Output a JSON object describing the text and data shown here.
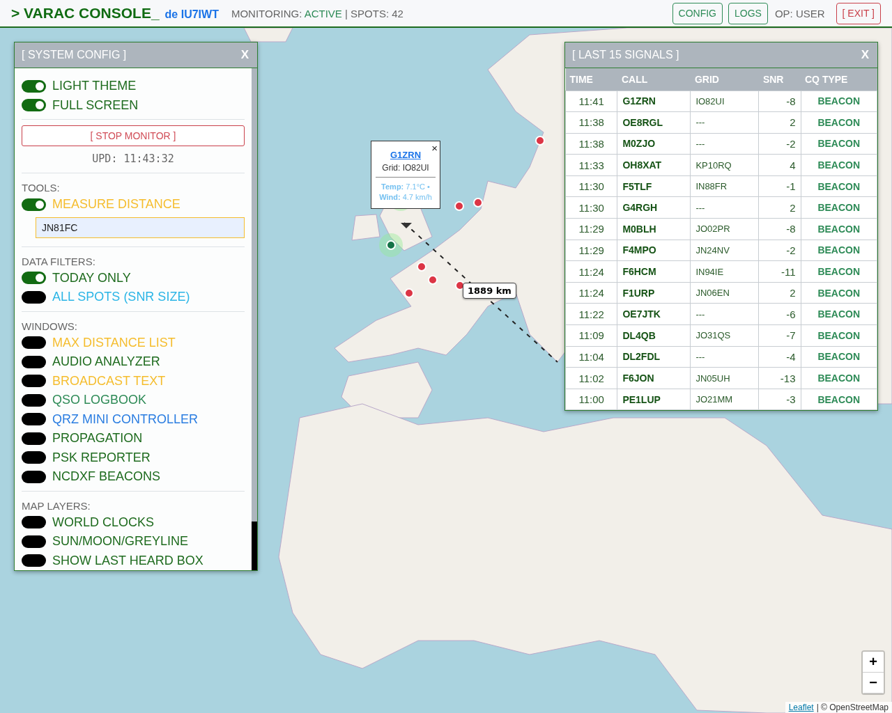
{
  "header": {
    "prompt": ">",
    "title": "VARAC CONSOLE_",
    "callsign": "de IU7IWT",
    "monitoring_label": "MONITORING:",
    "monitoring_value": "ACTIVE",
    "spots": "| SPOTS: 42",
    "buttons": [
      "CONFIG",
      "LOGS"
    ],
    "operator": "OP: USER",
    "exit": "[ EXIT ]"
  },
  "config_panel": {
    "title": "[ SYSTEM CONFIG ]",
    "close": "X",
    "top_toggles": [
      {
        "label": "LIGHT THEME",
        "on": true,
        "color": "#1e6b1e"
      },
      {
        "label": "FULL SCREEN",
        "on": true,
        "color": "#1e6b1e"
      }
    ],
    "stop_button": "[ STOP MONITOR ]",
    "updated": "UPD: 11:43:32",
    "sections": [
      {
        "title": "TOOLS:",
        "toggles": [
          {
            "label": "MEASURE DISTANCE",
            "on": true,
            "color": "#f5bd2e"
          }
        ],
        "locator": "JN81FC"
      },
      {
        "title": "DATA FILTERS:",
        "toggles": [
          {
            "label": "TODAY ONLY",
            "on": true,
            "color": "#1e6b1e"
          },
          {
            "label": "ALL SPOTS (SNR SIZE)",
            "on": false,
            "color": "#2bb5e6"
          }
        ]
      },
      {
        "title": "WINDOWS:",
        "toggles": [
          {
            "label": "MAX DISTANCE LIST",
            "on": false,
            "color": "#f5bd2e"
          },
          {
            "label": "AUDIO ANALYZER",
            "on": false,
            "color": "#1e6b1e"
          },
          {
            "label": "BROADCAST TEXT",
            "on": false,
            "color": "#f5bd2e"
          },
          {
            "label": "QSO LOGBOOK",
            "on": false,
            "color": "#2e8b57"
          },
          {
            "label": "QRZ MINI CONTROLLER",
            "on": false,
            "color": "#2a7de1"
          },
          {
            "label": "PROPAGATION",
            "on": false,
            "color": "#1e6b1e"
          },
          {
            "label": "PSK REPORTER",
            "on": false,
            "color": "#1e6b1e"
          },
          {
            "label": "NCDXF BEACONS",
            "on": false,
            "color": "#1e6b1e"
          }
        ]
      },
      {
        "title": "MAP LAYERS:",
        "toggles": [
          {
            "label": "WORLD CLOCKS",
            "on": false,
            "color": "#1e6b1e"
          },
          {
            "label": "SUN/MOON/GREYLINE",
            "on": false,
            "color": "#1e6b1e"
          },
          {
            "label": "SHOW LAST HEARD BOX",
            "on": false,
            "color": "#1e6b1e"
          }
        ]
      }
    ]
  },
  "signals_panel": {
    "title": "[ LAST 15 SIGNALS ]",
    "close": "X",
    "columns": [
      "TIME",
      "CALL",
      "GRID",
      "SNR",
      "CQ TYPE"
    ],
    "rows": [
      [
        "11:41",
        "G1ZRN",
        "IO82UI",
        "-8",
        "BEACON"
      ],
      [
        "11:38",
        "OE8RGL",
        "---",
        "2",
        "BEACON"
      ],
      [
        "11:38",
        "M0ZJO",
        "---",
        "-2",
        "BEACON"
      ],
      [
        "11:33",
        "OH8XAT",
        "KP10RQ",
        "4",
        "BEACON"
      ],
      [
        "11:30",
        "F5TLF",
        "IN88FR",
        "-1",
        "BEACON"
      ],
      [
        "11:30",
        "G4RGH",
        "---",
        "2",
        "BEACON"
      ],
      [
        "11:29",
        "M0BLH",
        "JO02PR",
        "-8",
        "BEACON"
      ],
      [
        "11:29",
        "F4MPO",
        "JN24NV",
        "-2",
        "BEACON"
      ],
      [
        "11:24",
        "F6HCM",
        "IN94IE",
        "-11",
        "BEACON"
      ],
      [
        "11:24",
        "F1URP",
        "JN06EN",
        "2",
        "BEACON"
      ],
      [
        "11:22",
        "OE7JTK",
        "---",
        "-6",
        "BEACON"
      ],
      [
        "11:09",
        "DL4QB",
        "JO31QS",
        "-7",
        "BEACON"
      ],
      [
        "11:04",
        "DL2FDL",
        "---",
        "-4",
        "BEACON"
      ],
      [
        "11:02",
        "F6JON",
        "JN05UH",
        "-13",
        "BEACON"
      ],
      [
        "11:00",
        "PE1LUP",
        "JO21MM",
        "-3",
        "BEACON"
      ]
    ]
  },
  "popup": {
    "call": "G1ZRN",
    "grid": "Grid: IO82UI",
    "weather": "**Temp:** 7.1°C • **Wind:** 4.7 km/h",
    "close": "×"
  },
  "distance_label": "1889 km",
  "zoom_controls": [
    "+",
    "−"
  ],
  "attribution": {
    "link": "Leaflet",
    "text": "| © OpenStreetMap"
  }
}
